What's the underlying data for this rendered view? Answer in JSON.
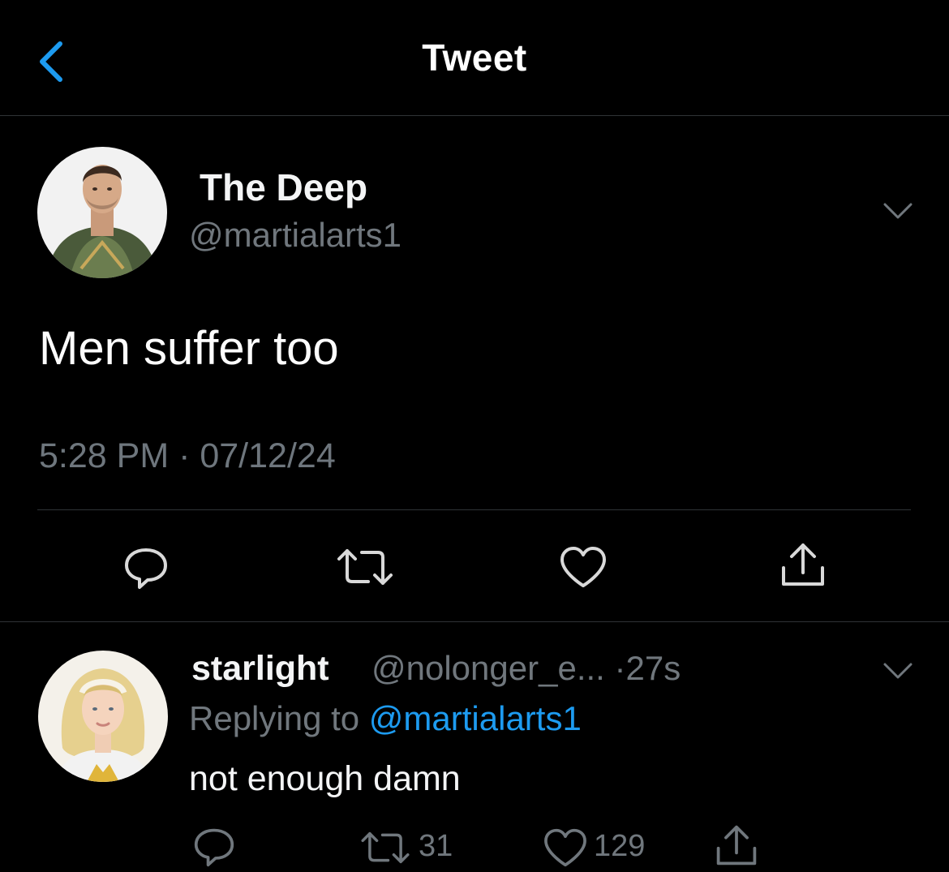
{
  "header": {
    "title": "Tweet",
    "back_icon": "chevron-left-icon",
    "accent": "#1d9bf0"
  },
  "tweet": {
    "display_name": "The Deep",
    "handle": "@martialarts1",
    "text": "Men suffer too",
    "timestamp": "5:28 PM · 07/12/24",
    "actions": [
      "reply-icon",
      "retweet-icon",
      "like-icon",
      "share-icon"
    ]
  },
  "reply": {
    "display_name": "starlight",
    "handle": "@nolonger_e...",
    "age": "·27s",
    "replying_prefix": "Replying to",
    "replying_mention": "@martialarts1",
    "text": "not enough damn",
    "retweet_count": "31",
    "like_count": "129",
    "actions": [
      "reply-icon",
      "retweet-icon",
      "like-icon",
      "share-icon"
    ]
  },
  "colors": {
    "background": "#000000",
    "secondary_text": "#70777d",
    "divider": "#2f3336",
    "link": "#1d9bf0"
  }
}
